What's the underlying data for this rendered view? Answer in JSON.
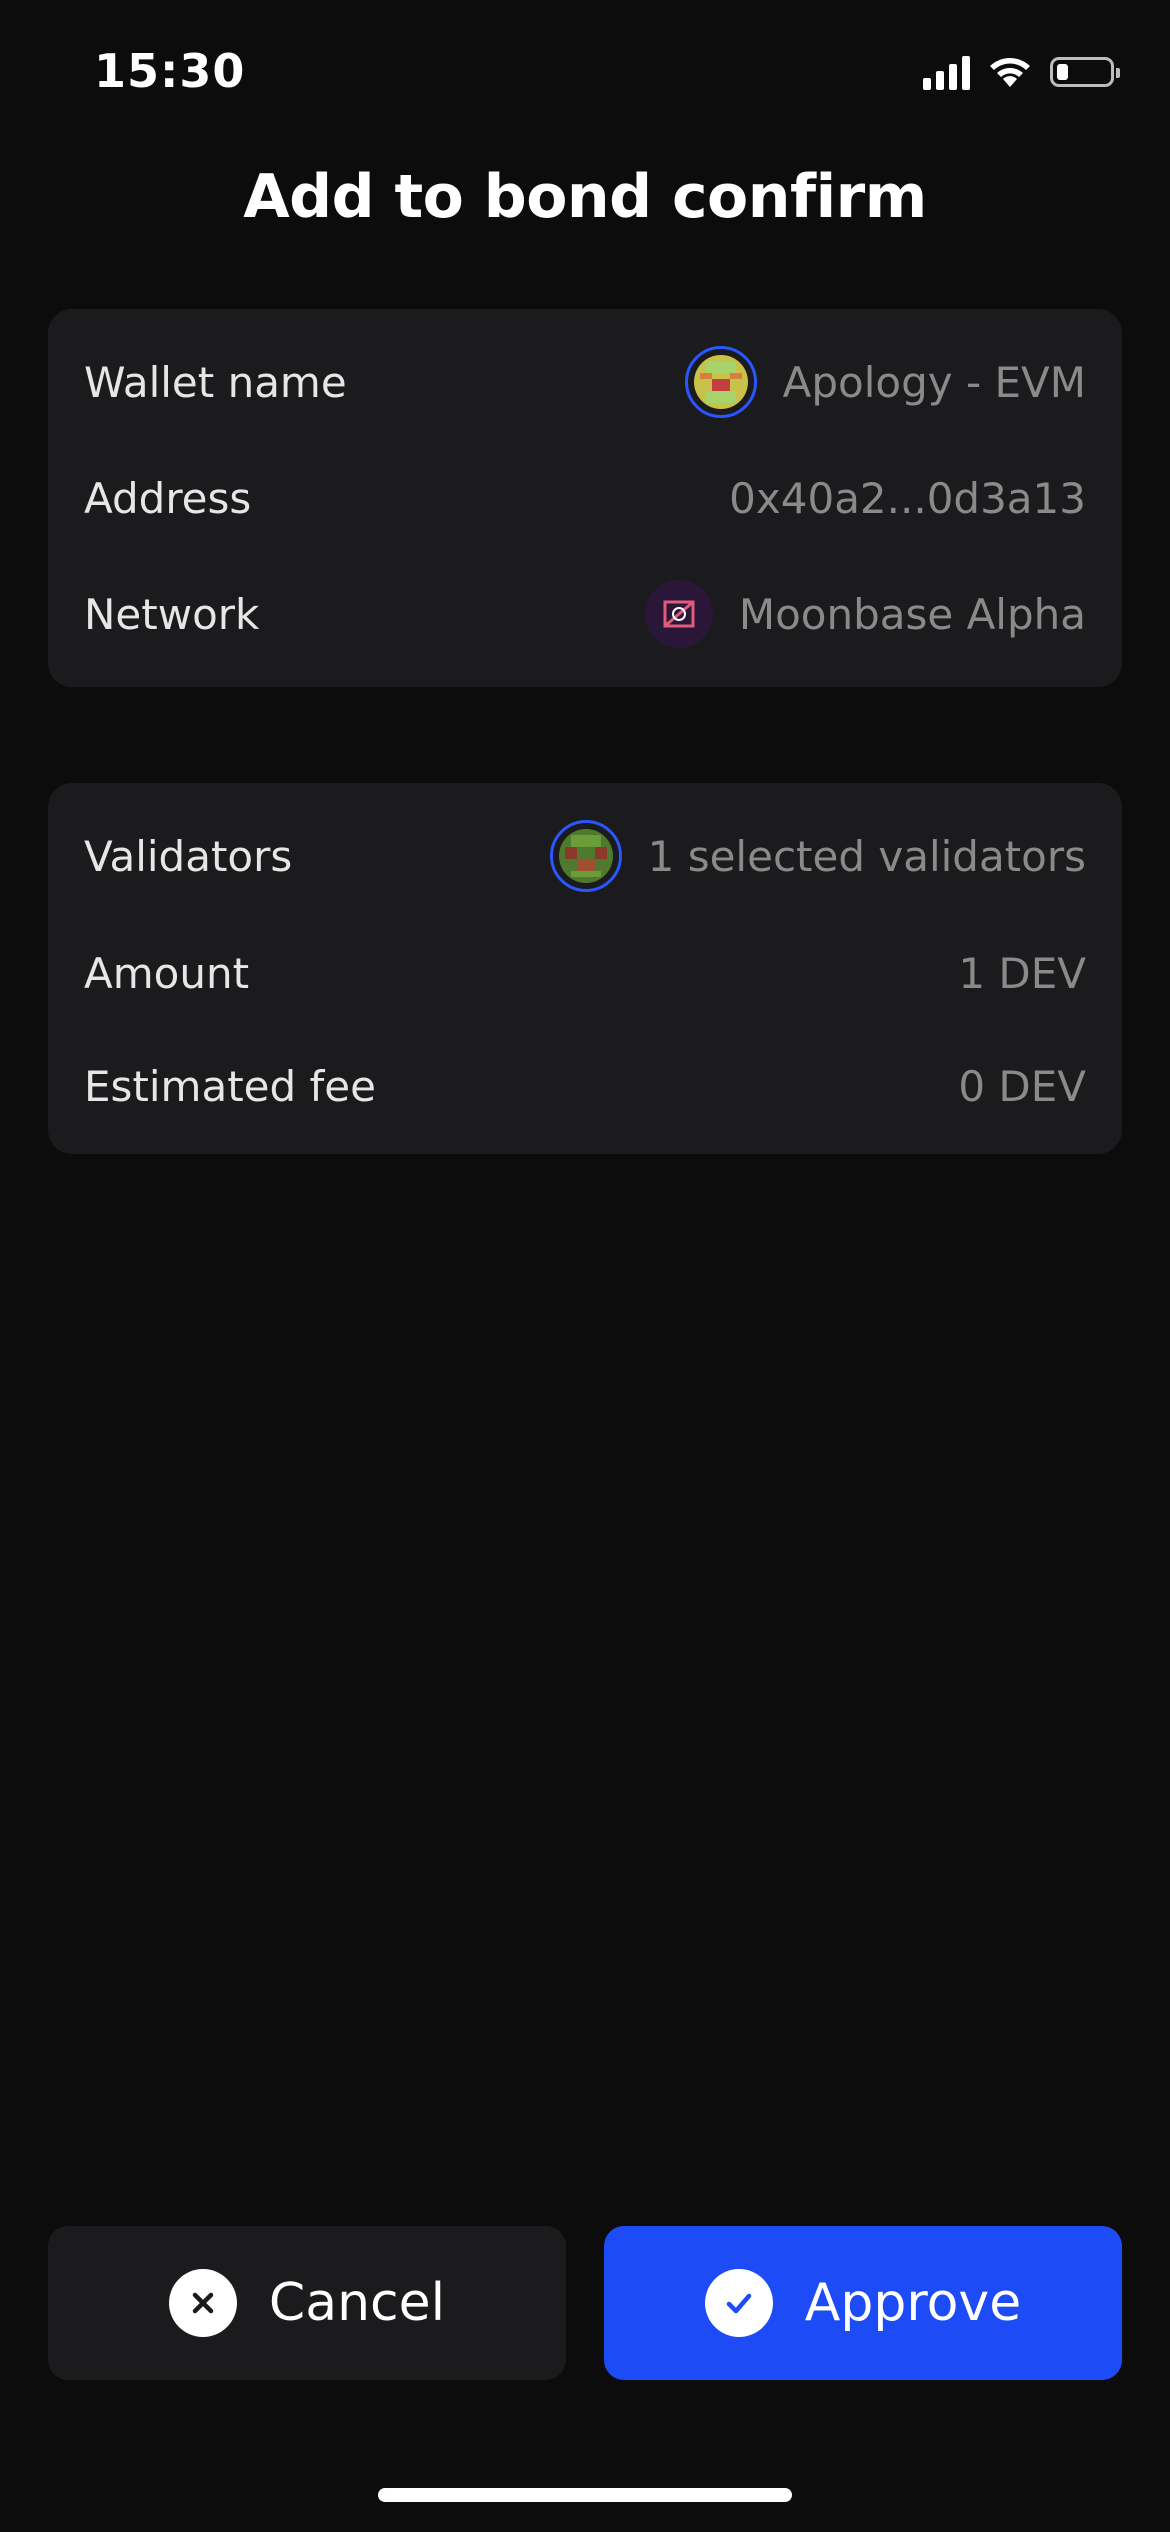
{
  "status_bar": {
    "time": "15:30"
  },
  "title": "Add to bond confirm",
  "account_card": {
    "wallet_name_label": "Wallet name",
    "wallet_name_value": "Apology - EVM",
    "address_label": "Address",
    "address_value": "0x40a2...0d3a13",
    "network_label": "Network",
    "network_value": "Moonbase Alpha"
  },
  "details_card": {
    "validators_label": "Validators",
    "validators_value": "1 selected validators",
    "amount_label": "Amount",
    "amount_value": "1 DEV",
    "fee_label": "Estimated fee",
    "fee_value": "0 DEV"
  },
  "actions": {
    "cancel_label": "Cancel",
    "approve_label": "Approve"
  },
  "colors": {
    "background": "#0c0c0c",
    "card": "#1b1b1d",
    "accent": "#1d4bf5",
    "muted_text": "#8a8a8a"
  },
  "icons": {
    "cellular": "cellular-signal-icon",
    "wifi": "wifi-icon",
    "battery": "battery-icon",
    "wallet_avatar": "wallet-avatar-icon",
    "network": "moonbase-alpha-icon",
    "validator_avatar": "validator-avatar-icon",
    "cancel": "close-icon",
    "approve": "checkmark-icon"
  }
}
